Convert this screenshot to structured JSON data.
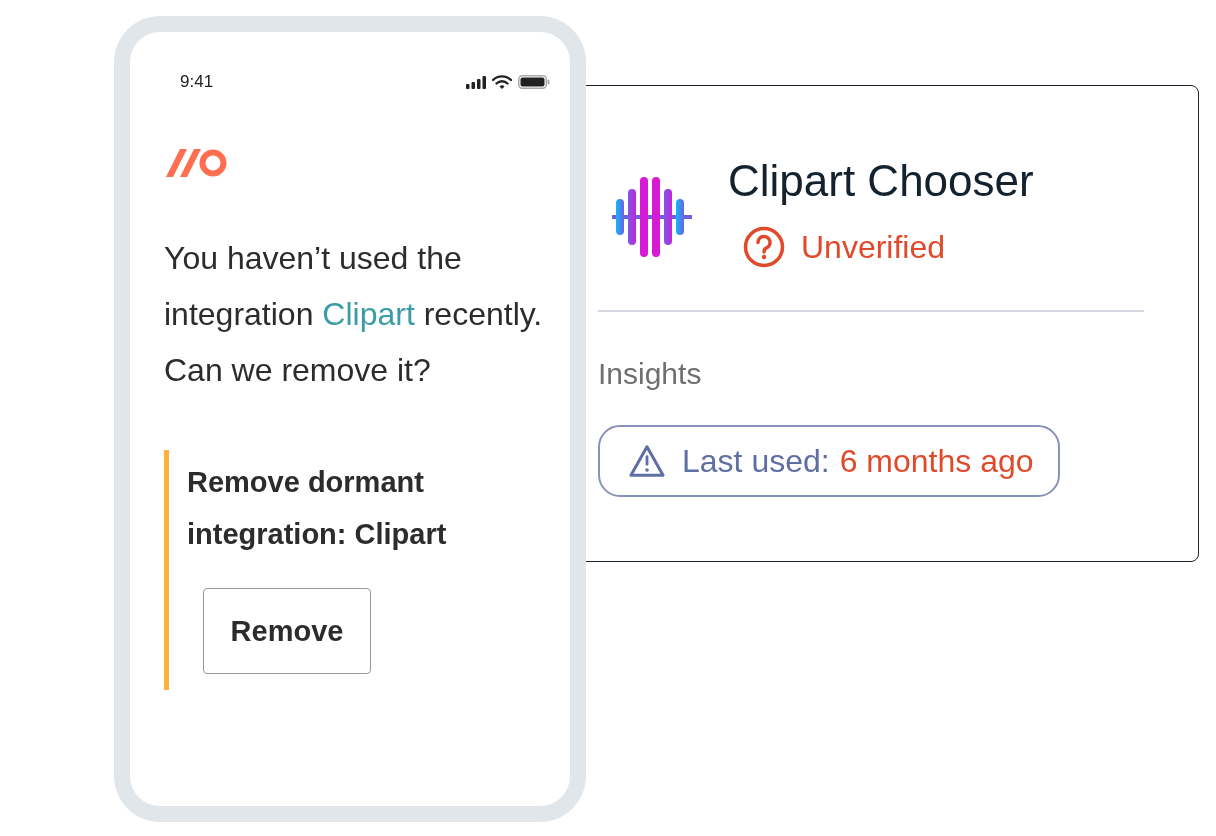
{
  "phone": {
    "status_bar": {
      "time": "9:41"
    },
    "message": {
      "before": "You haven’t used the integration",
      "link": "Clipart",
      "after": "recently.",
      "question": "Can we remove it?"
    },
    "task": {
      "title": "Remove dormant integration: Clipart",
      "button": "Remove"
    }
  },
  "card": {
    "title": "Clipart Chooser",
    "status": "Unverified",
    "section": "Insights",
    "insight": {
      "label": "Last used:",
      "value": "6 months ago"
    }
  }
}
